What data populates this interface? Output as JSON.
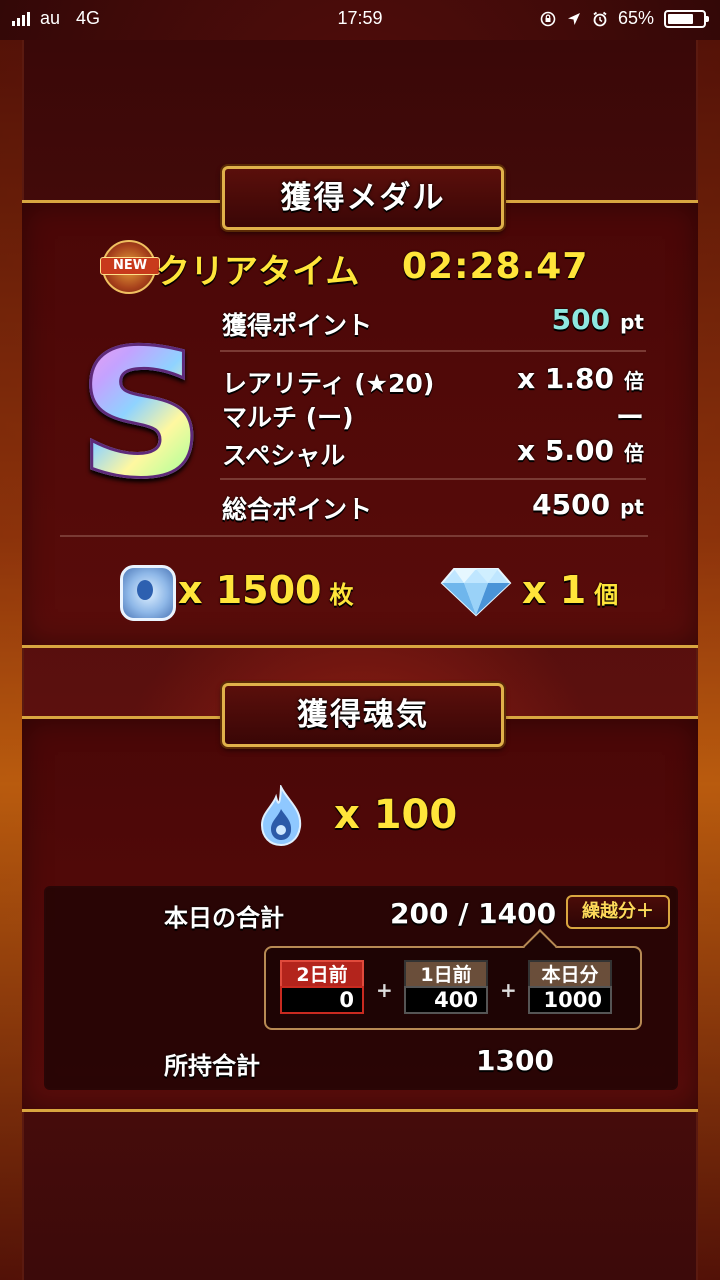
{
  "status_bar": {
    "carrier": "au",
    "network": "4G",
    "time": "17:59",
    "battery": "65%"
  },
  "medal_section": {
    "title": "獲得メダル",
    "new_badge": "NEW",
    "clear_time_label": "クリアタイム",
    "clear_time_value": "02:28.47",
    "rank": "S",
    "rows": [
      {
        "label": "獲得ポイント",
        "value": "500",
        "unit": "pt"
      },
      {
        "label": "レアリティ (★20)",
        "value": "x 1.80",
        "unit": "倍"
      },
      {
        "label": "マルチ (ー)",
        "value": "ー",
        "unit": ""
      },
      {
        "label": "スペシャル",
        "value": "x 5.00",
        "unit": "倍"
      },
      {
        "label": "総合ポイント",
        "value": "4500",
        "unit": "pt"
      }
    ],
    "medal_reward": {
      "icon": "medal-icon",
      "value": "x 1500",
      "unit": "枚"
    },
    "gem_reward": {
      "icon": "diamond-icon",
      "value": "x 1",
      "unit": "個"
    },
    "colors": {
      "accent": "#ffe53a",
      "points": "#8fe8e0",
      "border": "#d9a640"
    }
  },
  "soul_section": {
    "title": "獲得魂気",
    "soul_icon": "soul-flame-icon",
    "amount": "x 100",
    "today_total_label": "本日の合計",
    "today_total_value": "200 / 1400",
    "carryover_label": "繰越分＋",
    "days": [
      {
        "label": "2日前",
        "value": "0"
      },
      {
        "label": "1日前",
        "value": "400"
      },
      {
        "label": "本日分",
        "value": "1000"
      }
    ],
    "plus_sign": "+",
    "owned_total_label": "所持合計",
    "owned_total_value": "1300"
  }
}
